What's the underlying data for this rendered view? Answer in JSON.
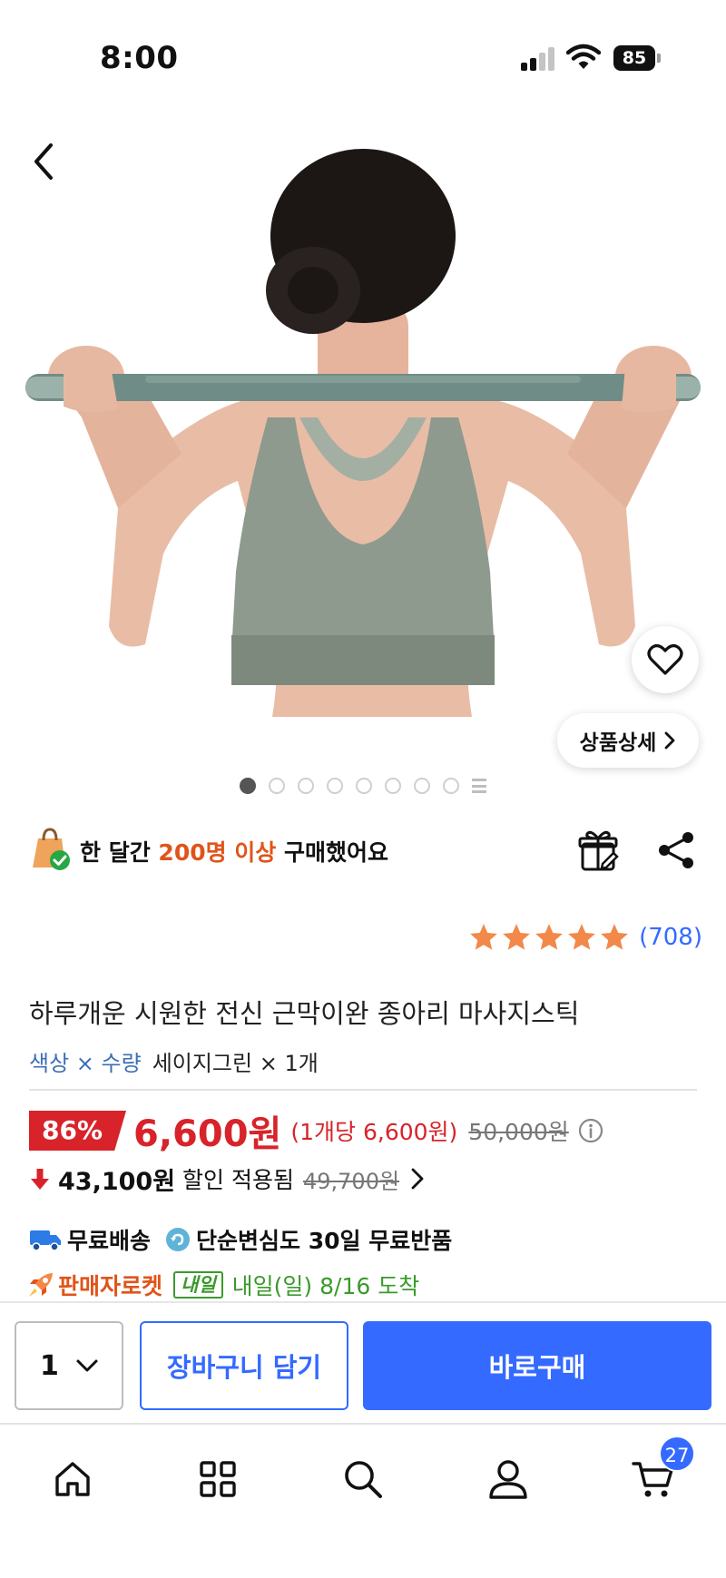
{
  "status_bar": {
    "time": "8:00",
    "battery": "85"
  },
  "hero": {
    "detail_label": "상품상세",
    "page_dots_total": 8,
    "page_dots_active": 1
  },
  "purchase": {
    "prefix": "한 달간 ",
    "highlight": "200명 이상",
    "suffix": " 구매했어요"
  },
  "rating": {
    "stars": 5,
    "review_count": "(708)"
  },
  "product": {
    "title": "하루개운 시원한 전신 근막이완 종아리 마사지스틱",
    "option_label": "색상 × 수량",
    "option_value": "세이지그린 × 1개"
  },
  "price": {
    "discount": "86%",
    "sale_price": "6,600원",
    "unit_price": "(1개당 6,600원)",
    "original_price": "50,000원"
  },
  "coupon": {
    "price": "43,100원",
    "text": "할인 적용됨",
    "before": "49,700원"
  },
  "shipping": {
    "free": "무료배송",
    "return": "단순변심도 30일 무료반품"
  },
  "delivery": {
    "seller_rocket": "판매자로켓",
    "badge": "내일",
    "arrival": "내일(일) 8/16 도착"
  },
  "actions": {
    "quantity": "1",
    "add_to_cart": "장바구니 담기",
    "buy_now": "바로구매"
  },
  "tab_bar": {
    "cart_count": "27"
  },
  "colors": {
    "accent_blue": "#346aff",
    "sale_red": "#d8232a",
    "highlight_orange": "#e0541a",
    "delivery_green": "#3a9a2a",
    "star_orange": "#f2894a"
  },
  "icons": [
    "back-icon",
    "heart-icon",
    "chevron-right-icon",
    "shopping-bag-check-icon",
    "gift-icon",
    "share-icon",
    "star-icon",
    "info-icon",
    "down-arrow-icon",
    "truck-icon",
    "return-icon",
    "rocket-icon",
    "chevron-down-icon",
    "home-icon",
    "categories-icon",
    "search-icon",
    "user-icon",
    "cart-icon"
  ]
}
